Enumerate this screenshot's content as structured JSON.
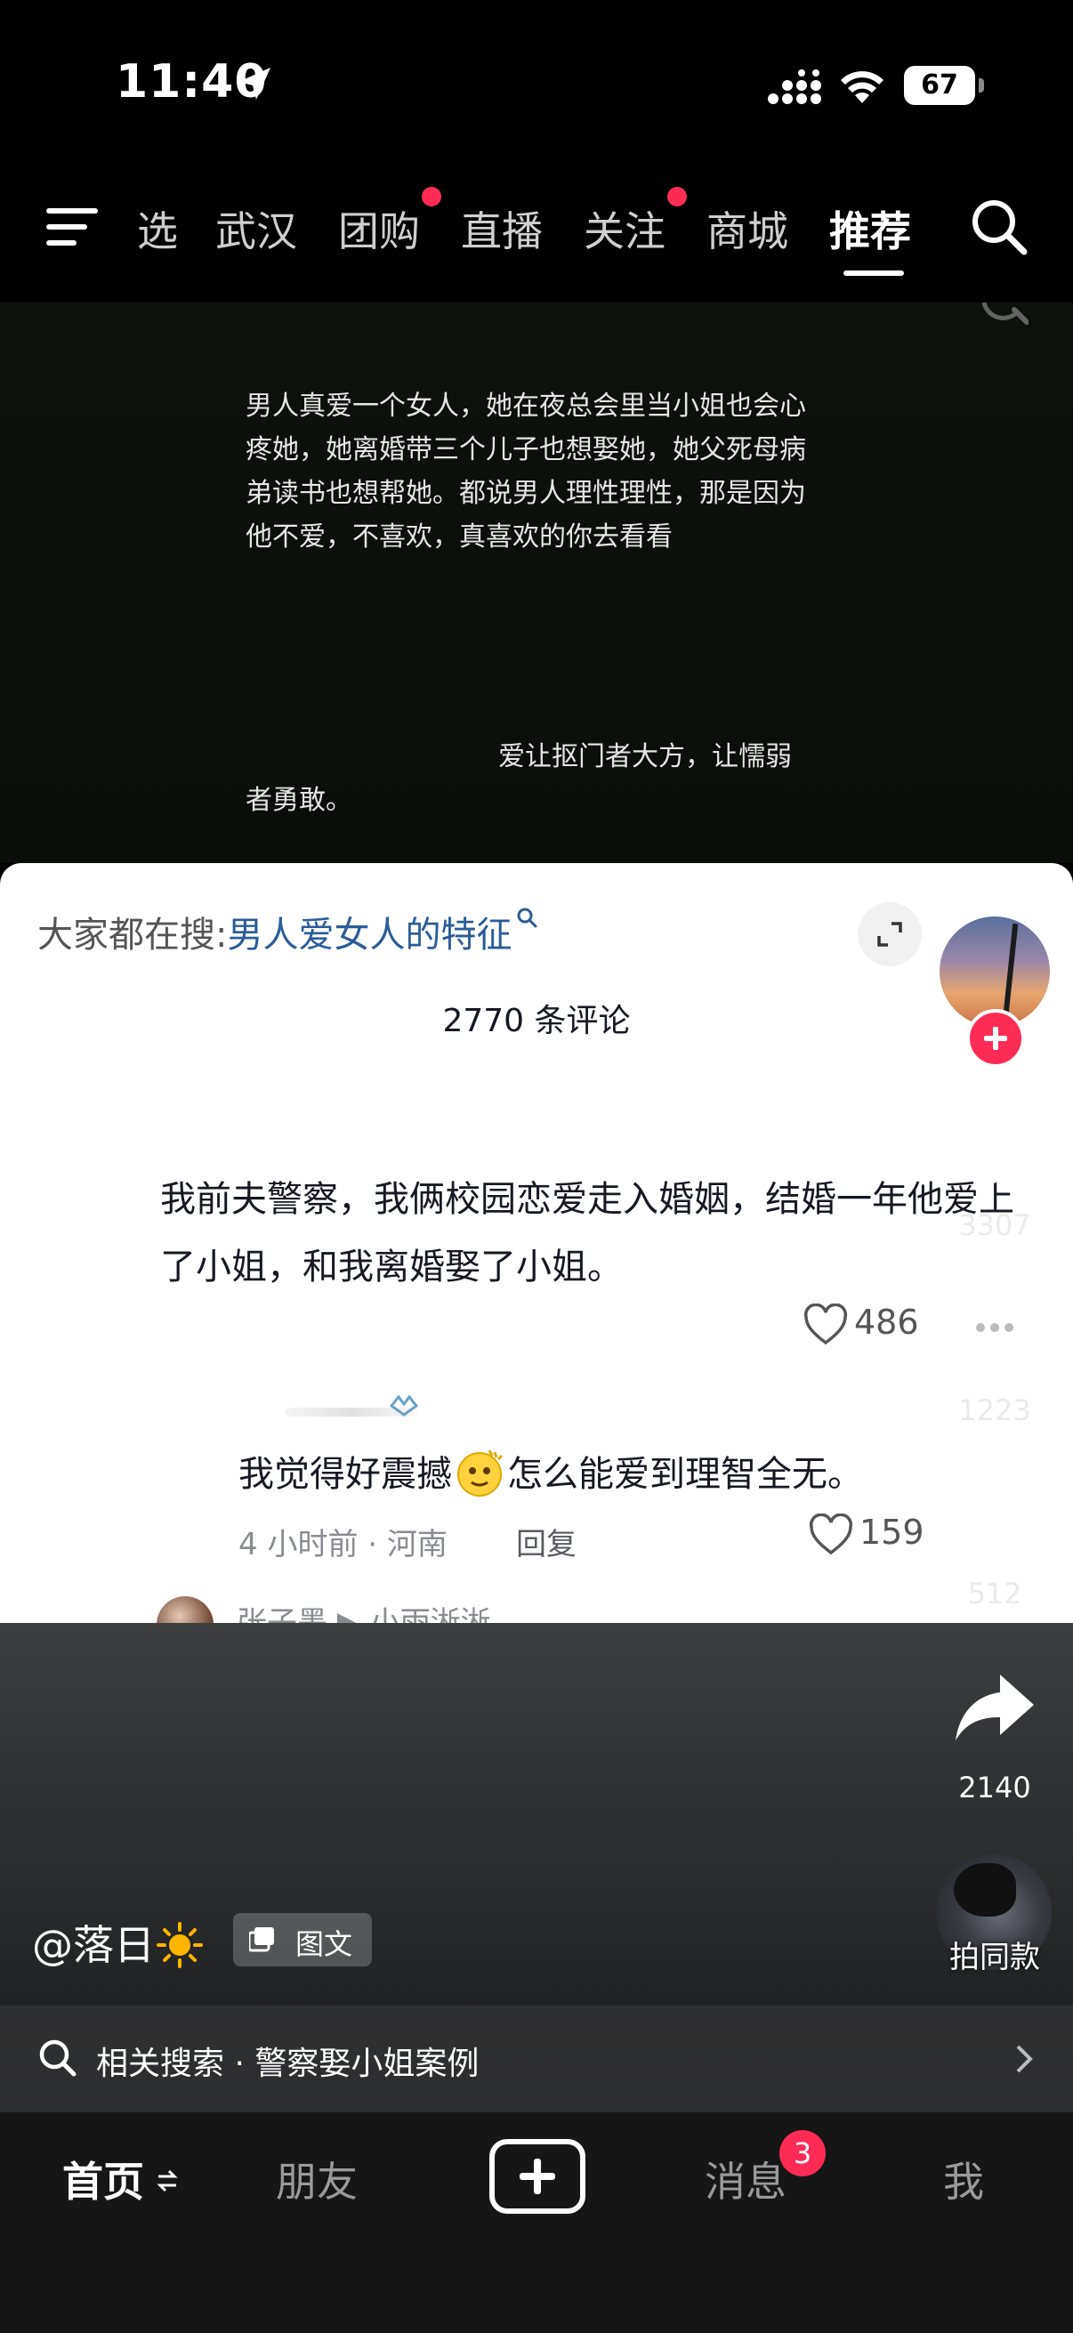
{
  "status_bar": {
    "time": "11:40",
    "battery": "67"
  },
  "top_nav": {
    "tabs": [
      {
        "label": "选",
        "dot": false
      },
      {
        "label": "武汉",
        "dot": false
      },
      {
        "label": "团购",
        "dot": true
      },
      {
        "label": "直播",
        "dot": false
      },
      {
        "label": "关注",
        "dot": true
      },
      {
        "label": "商城",
        "dot": false
      },
      {
        "label": "推荐",
        "dot": false,
        "active": true
      }
    ],
    "dot_color": "#fe2c55"
  },
  "post": {
    "paragraph1": "男人真爱一个女人，她在夜总会里当小姐也会心疼她，她离婚带三个儿子也想娶她，她父死母病弟读书也想帮她。都说男人理性理性，那是因为他不爱，不喜欢，真喜欢的你去看看",
    "paragraph2": "爱让抠门者大方，让懦弱者勇敢。"
  },
  "comments_sheet": {
    "hot_search_prefix": "大家都在搜:",
    "hot_search_keyword": "男人爱女人的特征",
    "keyword_color": "#2a5c99",
    "count": "2770 条评论",
    "comment1": {
      "text": "我前夫警察，我俩校园恋爱走入婚姻，结婚一年他爱上了小姐，和我离婚娶了小姐。",
      "likes": "486"
    },
    "comment2": {
      "text_before": "我觉得好震撼",
      "text_after": "怎么能爱到理智全无。",
      "meta": "4 小时前 · 河南",
      "reply_label": "回复",
      "likes": "159"
    },
    "comment3_partial": "张子墨 ▶ 小雨淅淅"
  },
  "actions": {
    "likes": "3307",
    "comments": "1223",
    "favorites": "512",
    "shares": "2140",
    "same_style": "拍同款"
  },
  "author": {
    "name": "@落日",
    "tag": "图文"
  },
  "related_search": {
    "text": "相关搜索 · 警察娶小姐案例"
  },
  "tab_bar": {
    "home": "首页",
    "friends": "朋友",
    "messages": "消息",
    "messages_badge": "3",
    "me": "我"
  }
}
